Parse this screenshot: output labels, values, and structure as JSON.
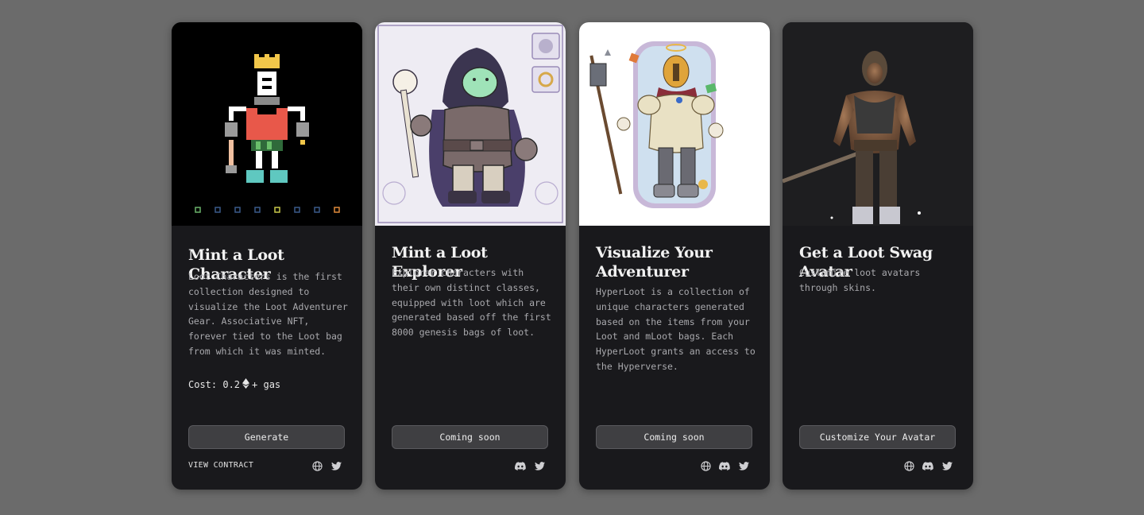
{
  "cards": [
    {
      "title": "Mint a Loot Character",
      "description": "Loot Characters is the first collection designed to visualize the Loot Adventurer Gear. Associative NFT, forever tied to the Loot bag from which it was minted.",
      "cost_prefix": "Cost: 0.2",
      "cost_suffix": "+ gas",
      "button_label": "Generate",
      "contract_label": "VIEW CONTRACT",
      "icons": [
        "globe-icon",
        "twitter-icon"
      ]
    },
    {
      "title": "Mint a Loot Explorer",
      "description": "Explorer characters with their own distinct classes, equipped with loot which are generated based off the first 8000 genesis bags of loot.",
      "button_label": "Coming soon",
      "icons": [
        "discord-icon",
        "twitter-icon"
      ]
    },
    {
      "title": "Visualize Your Adventurer",
      "description": "HyperLoot is a collection of unique characters generated based on the items from your Loot and mLoot bags. Each HyperLoot grants an access to the Hyperverse.",
      "button_label": "Coming soon",
      "icons": [
        "globe-icon",
        "discord-icon",
        "twitter-icon"
      ]
    },
    {
      "title": "Get a Loot Swag Avatar",
      "description": "Customize loot avatars through skins.",
      "button_label": "Customize Your Avatar",
      "icons": [
        "globe-icon",
        "discord-icon",
        "twitter-icon"
      ]
    }
  ],
  "colors": {
    "page_background": "#6b6b6b",
    "card_background": "#19191c",
    "button_background": "#3f3f42",
    "text_primary": "#f2f2f2",
    "text_secondary": "#a9a9ad"
  }
}
